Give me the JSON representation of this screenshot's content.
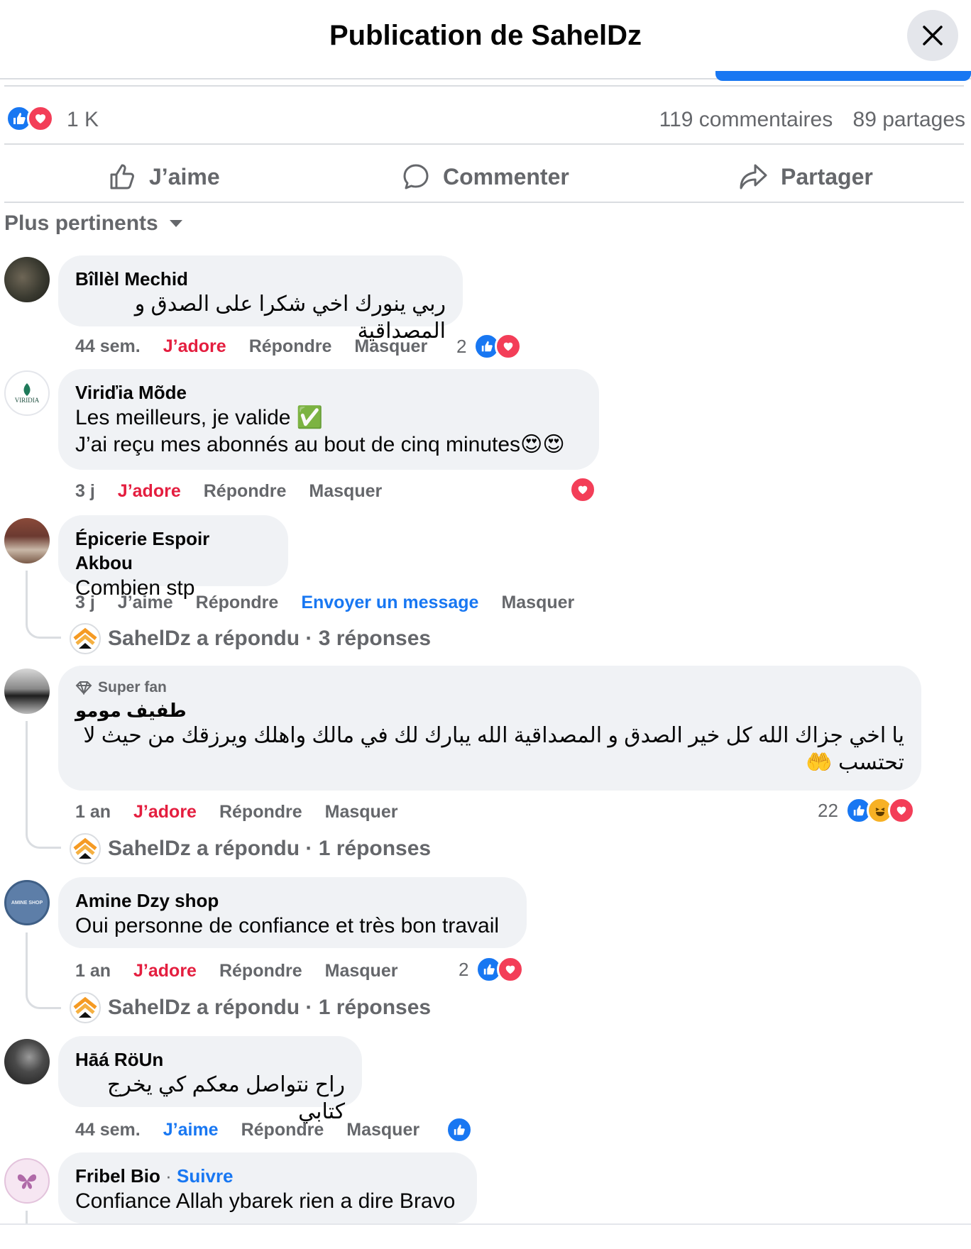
{
  "header": {
    "title": "Publication de SahelDz"
  },
  "stats": {
    "reactions_count": "1 K",
    "comments": "119 commentaires",
    "shares": "89 partages"
  },
  "actions": {
    "like": "J’aime",
    "comment": "Commenter",
    "share": "Partager"
  },
  "sort": {
    "label": "Plus pertinents"
  },
  "comments": [
    {
      "name": "Bîllèl Mechid",
      "text": "ربي ينورك اخي شكرا على الصدق و المصداقية",
      "time": "44 sem.",
      "react_label": "J’adore",
      "reply": "Répondre",
      "hide": "Masquer",
      "reaction_count": "2"
    },
    {
      "name": "Viriďia Mõde",
      "text_line1": "Les meilleurs, je valide ✅",
      "text_line2": "J’ai reçu mes abonnés au bout de cinq minutes😍😍",
      "time": "3 j",
      "react_label": "J’adore",
      "reply": "Répondre",
      "hide": "Masquer"
    },
    {
      "name": "Épicerie Espoir Akbou",
      "text": "Combien stp",
      "time": "3 j",
      "react_label": "J’aime",
      "reply": "Répondre",
      "message": "Envoyer un message",
      "hide": "Masquer",
      "replies": "SahelDz a répondu · 3 réponses"
    },
    {
      "badge": "Super fan",
      "name": "طفيف مومو",
      "text_line1": "يا اخي جزاك الله كل خير الصدق و المصداقية الله يبارك لك في مالك واهلك ويرزقك من حيث لا",
      "text_line2": "تحتسب 🤲",
      "time": "1 an",
      "react_label": "J’adore",
      "reply": "Répondre",
      "hide": "Masquer",
      "reaction_count": "22",
      "replies": "SahelDz a répondu · 1 réponses"
    },
    {
      "name": "Amine Dzy shop",
      "text": "Oui personne de confiance et très bon travail",
      "time": "1 an",
      "react_label": "J’adore",
      "reply": "Répondre",
      "hide": "Masquer",
      "reaction_count": "2",
      "replies": "SahelDz a répondu · 1 réponses",
      "avatar_text": "AMINE SHOP"
    },
    {
      "name": "Hāá RöUn",
      "text": "راح نتواصل معكم كي يخرج كتابي",
      "time": "44 sem.",
      "react_label": "J’aime",
      "reply": "Répondre",
      "hide": "Masquer"
    },
    {
      "name": "Fribel Bio",
      "follow": "Suivre",
      "text": "Confiance Allah ybarek rien a dire Bravo"
    }
  ],
  "avatar_logo_text": "VIRIDIA",
  "colors": {
    "brand_blue": "#1877f2",
    "love_red": "#e41e3f",
    "secondary_text": "#65676b",
    "bubble_bg": "#f0f2f5"
  }
}
